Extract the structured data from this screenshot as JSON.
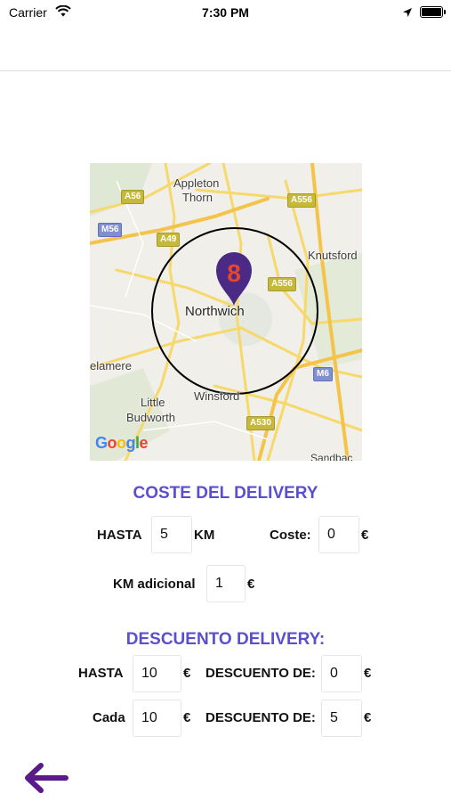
{
  "status_bar": {
    "carrier": "Carrier",
    "time": "7:30 PM",
    "icons": [
      "wifi-icon",
      "location-arrow-icon",
      "battery-icon"
    ]
  },
  "map": {
    "places": [
      "Appleton",
      "Thorn",
      "Knutsford",
      "Northwich",
      "elamere",
      "Little",
      "Budworth",
      "Winsford",
      "Sandbac"
    ],
    "roads": [
      "A56",
      "M56",
      "A49",
      "A556",
      "A556",
      "M6",
      "A530"
    ],
    "logo_text": "Google",
    "marker_icon": "map-pin-icon"
  },
  "delivery_cost": {
    "title": "COSTE DEL DELIVERY",
    "hasta_label": "HASTA",
    "hasta_value": "5",
    "km_unit": "KM",
    "coste_label": "Coste:",
    "coste_value": "0",
    "currency": "€",
    "km_adicional_label": "KM adicional",
    "km_adicional_value": "1"
  },
  "delivery_discount": {
    "title": "DESCUENTO DELIVERY:",
    "row1": {
      "label": "HASTA",
      "value": "10",
      "currency": "€",
      "discount_label": "DESCUENTO DE:",
      "discount_value": "0",
      "discount_currency": "€"
    },
    "row2": {
      "label": "Cada",
      "value": "10",
      "currency": "€",
      "discount_label": "DESCUENTO DE:",
      "discount_value": "5",
      "discount_currency": "€"
    }
  },
  "colors": {
    "accent": "#5a4fcf",
    "back_arrow": "#5b1a8c",
    "marker": "#4b2a86",
    "marker_inner": "#e8452c"
  },
  "back_icon": "arrow-left-icon"
}
